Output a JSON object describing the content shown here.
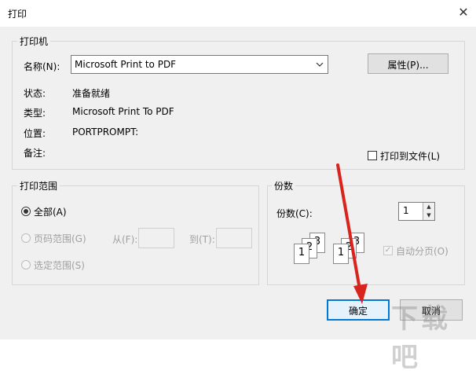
{
  "window": {
    "title": "打印",
    "close_glyph": "✕"
  },
  "printer": {
    "group_label": "打印机",
    "name_label": "名称(N):",
    "name_value": "Microsoft Print to PDF",
    "properties_button": "属性(P)...",
    "status_label": "状态:",
    "status_value": "准备就绪",
    "type_label": "类型:",
    "type_value": "Microsoft Print To PDF",
    "location_label": "位置:",
    "location_value": "PORTPROMPT:",
    "comment_label": "备注:",
    "print_to_file": "打印到文件(L)"
  },
  "range": {
    "group_label": "打印范围",
    "all": "全部(A)",
    "pages": "页码范围(G)",
    "from_label": "从(F):",
    "to_label": "到(T):",
    "selection": "选定范围(S)"
  },
  "copies": {
    "group_label": "份数",
    "count_label": "份数(C):",
    "count_value": "1",
    "collate": "自动分页(O)",
    "page_numbers": [
      "1",
      "2",
      "3"
    ]
  },
  "buttons": {
    "ok": "确定",
    "cancel": "取消"
  },
  "watermark": "下载吧",
  "colors": {
    "accent": "#0078d7",
    "arrow": "#d9231d"
  }
}
